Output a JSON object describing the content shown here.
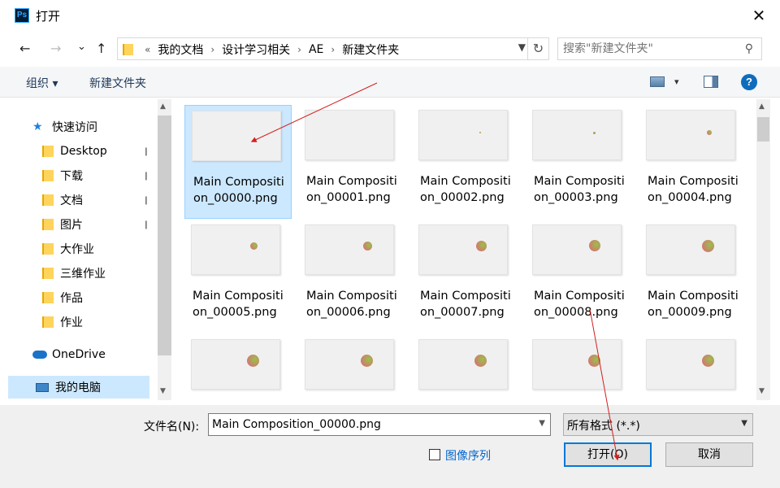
{
  "window": {
    "title": "打开",
    "app_icon_text": "Ps",
    "close_glyph": "✕"
  },
  "nav": {
    "back_glyph": "←",
    "forward_glyph": "→",
    "recent_glyph": "⌄",
    "up_glyph": "↑",
    "overflow": "«",
    "breadcrumbs": [
      "我的文档",
      "设计学习相关",
      "AE",
      "新建文件夹"
    ],
    "crumb_sep": "›",
    "refresh_glyph": "↻",
    "search_placeholder": "搜索\"新建文件夹\"",
    "search_glyph": "⚲"
  },
  "toolbar": {
    "organize_label": "组织 ▾",
    "new_folder_label": "新建文件夹",
    "view_drop_glyph": "▾",
    "help_glyph": "?"
  },
  "sidebar": {
    "quick_access": "快速访问",
    "pin_glyph": "📌",
    "items": [
      {
        "label": "Desktop",
        "pinned": true
      },
      {
        "label": "下载",
        "pinned": true
      },
      {
        "label": "文档",
        "pinned": true
      },
      {
        "label": "图片",
        "pinned": true
      },
      {
        "label": "大作业",
        "pinned": false
      },
      {
        "label": "三维作业",
        "pinned": false
      },
      {
        "label": "作品",
        "pinned": false
      },
      {
        "label": "作业",
        "pinned": false
      }
    ],
    "onedrive": "OneDrive",
    "this_pc": "我的电脑",
    "scroll_up": "▲",
    "scroll_down": "▼"
  },
  "files": {
    "items": [
      {
        "name": "Main Composition_00000.png",
        "dot": 0,
        "selected": true
      },
      {
        "name": "Main Composition_00001.png",
        "dot": 0
      },
      {
        "name": "Main Composition_00002.png",
        "dot": 1
      },
      {
        "name": "Main Composition_00003.png",
        "dot": 3
      },
      {
        "name": "Main Composition_00004.png",
        "dot": 6
      },
      {
        "name": "Main Composition_00005.png",
        "dot": 8
      },
      {
        "name": "Main Composition_00006.png",
        "dot": 11
      },
      {
        "name": "Main Composition_00007.png",
        "dot": 13
      },
      {
        "name": "Main Composition_00008.png",
        "dot": 15
      },
      {
        "name": "Main Composition_00009.png",
        "dot": 16
      },
      {
        "name": "",
        "dot": 16
      },
      {
        "name": "",
        "dot": 16
      },
      {
        "name": "",
        "dot": 16
      },
      {
        "name": "",
        "dot": 16
      },
      {
        "name": "",
        "dot": 16
      }
    ],
    "scroll_up": "▲",
    "scroll_down": "▼"
  },
  "footer": {
    "filename_label": "文件名(N):",
    "filename_value": "Main Composition_00000.png",
    "filetype_value": "所有格式 (*.*)",
    "combo_arrow": "▼",
    "sequence_label": "图像序列",
    "sequence_checked": false,
    "open_label": "打开(O)",
    "cancel_label": "取消"
  },
  "colors": {
    "selection": "#cce8ff",
    "accent": "#0078d7",
    "annotation_arrow": "#d21f1f"
  }
}
